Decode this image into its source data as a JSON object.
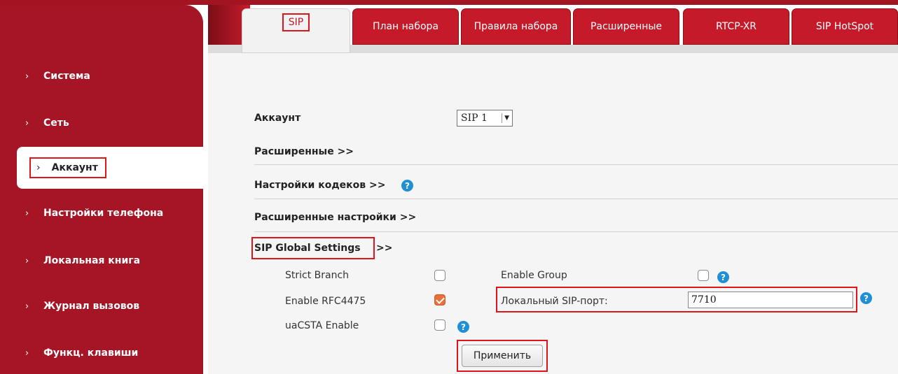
{
  "sidebar": {
    "items": [
      {
        "label": "Система"
      },
      {
        "label": "Сеть"
      },
      {
        "label": "Аккаунт"
      },
      {
        "label": "Настройки телефона"
      },
      {
        "label": "Локальная книга"
      },
      {
        "label": "Журнал вызовов"
      },
      {
        "label": "Функц. клавиши"
      }
    ],
    "chevron": "›"
  },
  "tabs": [
    {
      "label": "SIP"
    },
    {
      "label": "План набора"
    },
    {
      "label": "Правила набора"
    },
    {
      "label": "Расширенные"
    },
    {
      "label": "RTCP-XR"
    },
    {
      "label": "SIP HotSpot"
    }
  ],
  "main": {
    "account_label": "Аккаунт",
    "account_select": "SIP 1",
    "sections": {
      "advanced": "Расширенные >>",
      "codecs": "Настройки кодеков >>",
      "advanced_settings": "Расширенные настройки >>",
      "sip_global": "SIP Global Settings",
      "sip_global_suffix": ">>"
    },
    "settings": {
      "strict_branch": {
        "label": "Strict Branch",
        "checked": false
      },
      "enable_group": {
        "label": "Enable Group",
        "checked": false
      },
      "enable_rfc4475": {
        "label": "Enable RFC4475",
        "checked": true
      },
      "local_sip_port": {
        "label": "Локальный SIP-порт:",
        "value": "7710"
      },
      "uacsta_enable": {
        "label": "uaCSTA Enable",
        "checked": false
      }
    },
    "apply_label": "Применить",
    "help_glyph": "?"
  },
  "colors": {
    "brand_red": "#a51525",
    "tab_red": "#c41a2a",
    "highlight_red": "#e0141b",
    "checkbox_orange": "#e8703c",
    "help_blue": "#1f8fd6"
  }
}
